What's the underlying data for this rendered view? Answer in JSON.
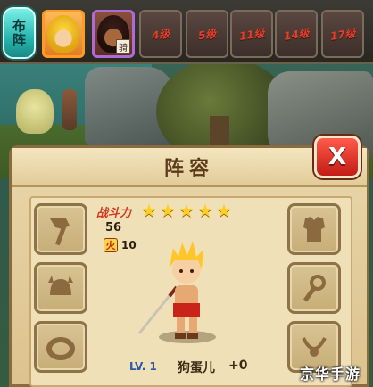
{
  "topbar": {
    "formation_label": "布阵",
    "slots": [
      {
        "type": "hero",
        "portrait": "blond-hero"
      },
      {
        "type": "hero",
        "portrait": "dark-haired-hero",
        "badge": "骑"
      },
      {
        "type": "locked",
        "label": "4级"
      },
      {
        "type": "locked",
        "label": "5级"
      },
      {
        "type": "locked",
        "label": "11级"
      },
      {
        "type": "locked",
        "label": "14级"
      },
      {
        "type": "locked",
        "label": "17级"
      }
    ]
  },
  "panel": {
    "title": "阵容",
    "close_label": "X",
    "equipment_left": [
      "axe-icon",
      "helmet-icon",
      "ring-icon"
    ],
    "equipment_right": [
      "armor-icon",
      "amulet-icon",
      "necklace-icon"
    ]
  },
  "hero": {
    "power_label": "战斗力",
    "stars": 5,
    "power_value": "56",
    "job_icon_char": "火",
    "job_value": "10",
    "level": "LV. 1",
    "name": "狗蛋儿",
    "plus": "+0"
  },
  "watermark": "京华手游",
  "colors": {
    "accent_teal": "#28b6b0",
    "close_red": "#c21c14",
    "lock_text": "#e2402c",
    "star": "#ffcf1e",
    "level_blue": "#2a5aa8"
  }
}
